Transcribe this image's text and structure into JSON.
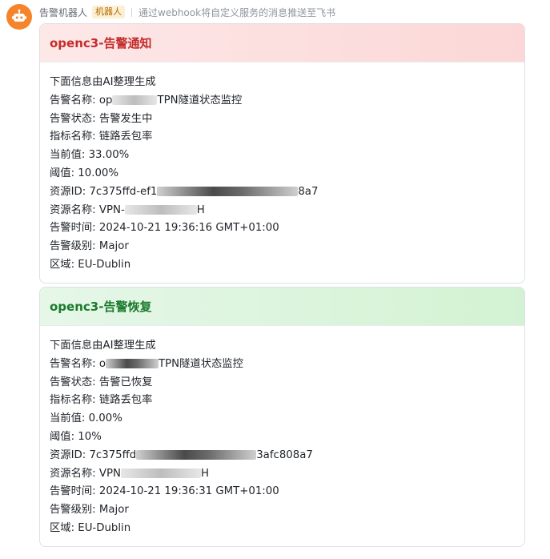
{
  "message": {
    "sender": "告警机器人",
    "badge": "机器人",
    "description": "通过webhook将自定义服务的消息推送至飞书",
    "accent_color": "#f5842b"
  },
  "cards": [
    {
      "title": "openc3-告警通知",
      "theme_color": "#c42b2b",
      "lines": [
        "下面信息由AI整理生成",
        "告警名称: op",
        "TPN隧道状态监控",
        "告警状态: 告警发生中",
        "指标名称: 链路丢包率",
        "当前值: 33.00%",
        "阈值: 10.00%",
        "资源ID: 7c375ffd-ef1",
        "8a7",
        "资源名称: VPN-",
        "H",
        "告警时间: 2024-10-21 19:36:16 GMT+01:00",
        "告警级别: Major",
        "区域: EU-Dublin"
      ]
    },
    {
      "title": "openc3-告警恢复",
      "theme_color": "#1c7a2d",
      "lines": [
        "下面信息由AI整理生成",
        "告警名称: o",
        "TPN隧道状态监控",
        "告警状态: 告警已恢复",
        "指标名称: 链路丢包率",
        "当前值: 0.00%",
        "阈值: 10%",
        "资源ID: 7c375ffd",
        "3afc808a7",
        "资源名称: VPN",
        "H",
        "告警时间: 2024-10-21 19:36:31 GMT+01:00",
        "告警级别: Major",
        "区域: EU-Dublin"
      ]
    }
  ]
}
